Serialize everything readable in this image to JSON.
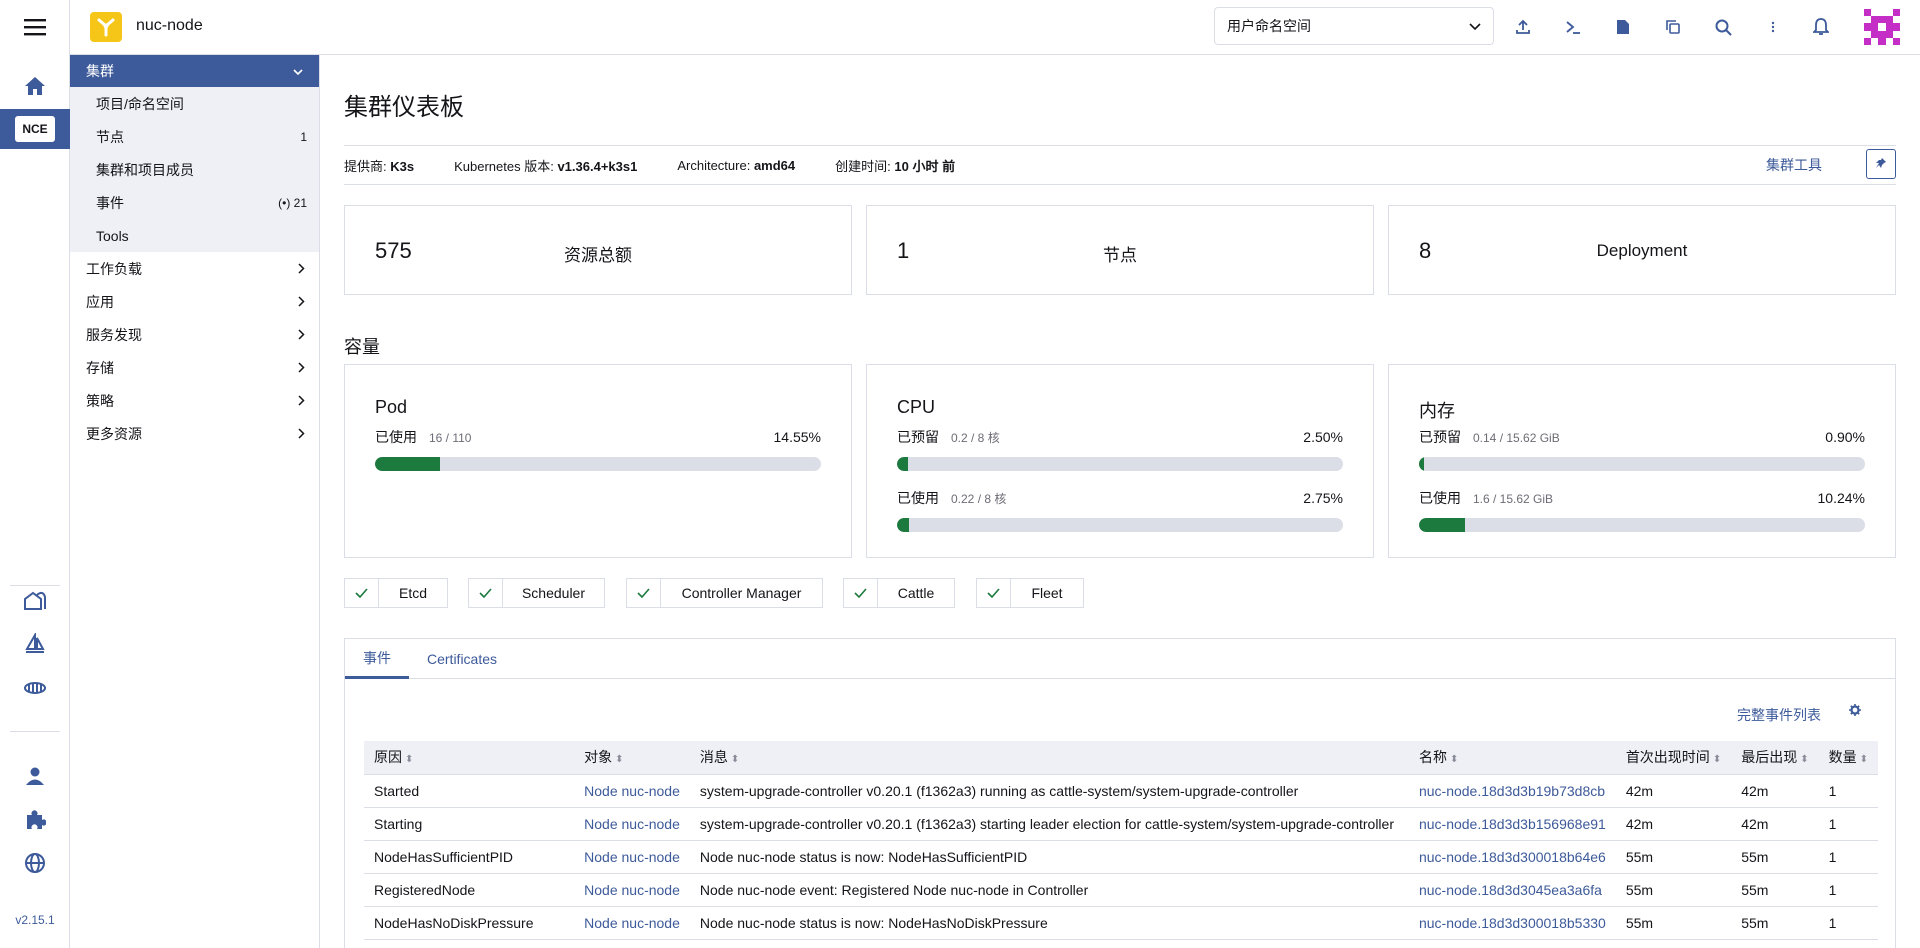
{
  "header": {
    "cluster_name": "nuc-node",
    "namespace_select": "用户命名空间"
  },
  "rail": {
    "cluster_badge": "NCE",
    "version": "v2.15.1"
  },
  "sidenav": {
    "group": "集群",
    "sub_items": [
      {
        "label": "项目/命名空间",
        "count": ""
      },
      {
        "label": "节点",
        "count": "1"
      },
      {
        "label": "集群和项目成员",
        "count": ""
      },
      {
        "label": "事件",
        "count": "(•) 21"
      },
      {
        "label": "Tools",
        "count": ""
      }
    ],
    "top_items": [
      "工作负载",
      "应用",
      "服务发现",
      "存储",
      "策略",
      "更多资源"
    ]
  },
  "page": {
    "title": "集群仪表板",
    "meta": {
      "provider_label": "提供商:",
      "provider": "K3s",
      "k8s_label": "Kubernetes 版本:",
      "k8s": "v1.36.4+k3s1",
      "arch_label": "Architecture:",
      "arch": "amd64",
      "created_label": "创建时间:",
      "created": "10 小时 前"
    },
    "tools_link": "集群工具"
  },
  "stats": [
    {
      "value": "575",
      "label": "资源总额"
    },
    {
      "value": "1",
      "label": "节点"
    },
    {
      "value": "8",
      "label": "Deployment"
    }
  ],
  "capacity": {
    "title": "容量",
    "cards": [
      {
        "title": "Pod",
        "bars": [
          {
            "label": "已使用",
            "detail": "16 / 110",
            "percent": "14.55%",
            "fraction": 0.1455
          }
        ]
      },
      {
        "title": "CPU",
        "bars": [
          {
            "label": "已预留",
            "detail": "0.2 / 8 核",
            "percent": "2.50%",
            "fraction": 0.025
          },
          {
            "label": "已使用",
            "detail": "0.22 / 8 核",
            "percent": "2.75%",
            "fraction": 0.0275
          }
        ]
      },
      {
        "title": "内存",
        "bars": [
          {
            "label": "已预留",
            "detail": "0.14 / 15.62 GiB",
            "percent": "0.90%",
            "fraction": 0.009
          },
          {
            "label": "已使用",
            "detail": "1.6 / 15.62 GiB",
            "percent": "10.24%",
            "fraction": 0.1024
          }
        ]
      }
    ]
  },
  "components": [
    "Etcd",
    "Scheduler",
    "Controller Manager",
    "Cattle",
    "Fleet"
  ],
  "events": {
    "tabs": [
      "事件",
      "Certificates"
    ],
    "full_list_link": "完整事件列表",
    "columns": [
      "原因",
      "对象",
      "消息",
      "名称",
      "首次出现时间",
      "最后出现",
      "数量"
    ],
    "rows": [
      [
        "Started",
        "Node nuc-node",
        "system-upgrade-controller v0.20.1 (f1362a3) running as cattle-system/system-upgrade-controller",
        "nuc-node.18d3d3b19b73d8cb",
        "42m",
        "42m",
        "1"
      ],
      [
        "Starting",
        "Node nuc-node",
        "system-upgrade-controller v0.20.1 (f1362a3) starting leader election for cattle-system/system-upgrade-controller",
        "nuc-node.18d3d3b156968e91",
        "42m",
        "42m",
        "1"
      ],
      [
        "NodeHasSufficientPID",
        "Node nuc-node",
        "Node nuc-node status is now: NodeHasSufficientPID",
        "nuc-node.18d3d300018b64e6",
        "55m",
        "55m",
        "1"
      ],
      [
        "RegisteredNode",
        "Node nuc-node",
        "Node nuc-node event: Registered Node nuc-node in Controller",
        "nuc-node.18d3d3045ea3a6fa",
        "55m",
        "55m",
        "1"
      ],
      [
        "NodeHasNoDiskPressure",
        "Node nuc-node",
        "Node nuc-node status is now: NodeHasNoDiskPressure",
        "nuc-node.18d3d300018b5330",
        "55m",
        "55m",
        "1"
      ]
    ]
  }
}
